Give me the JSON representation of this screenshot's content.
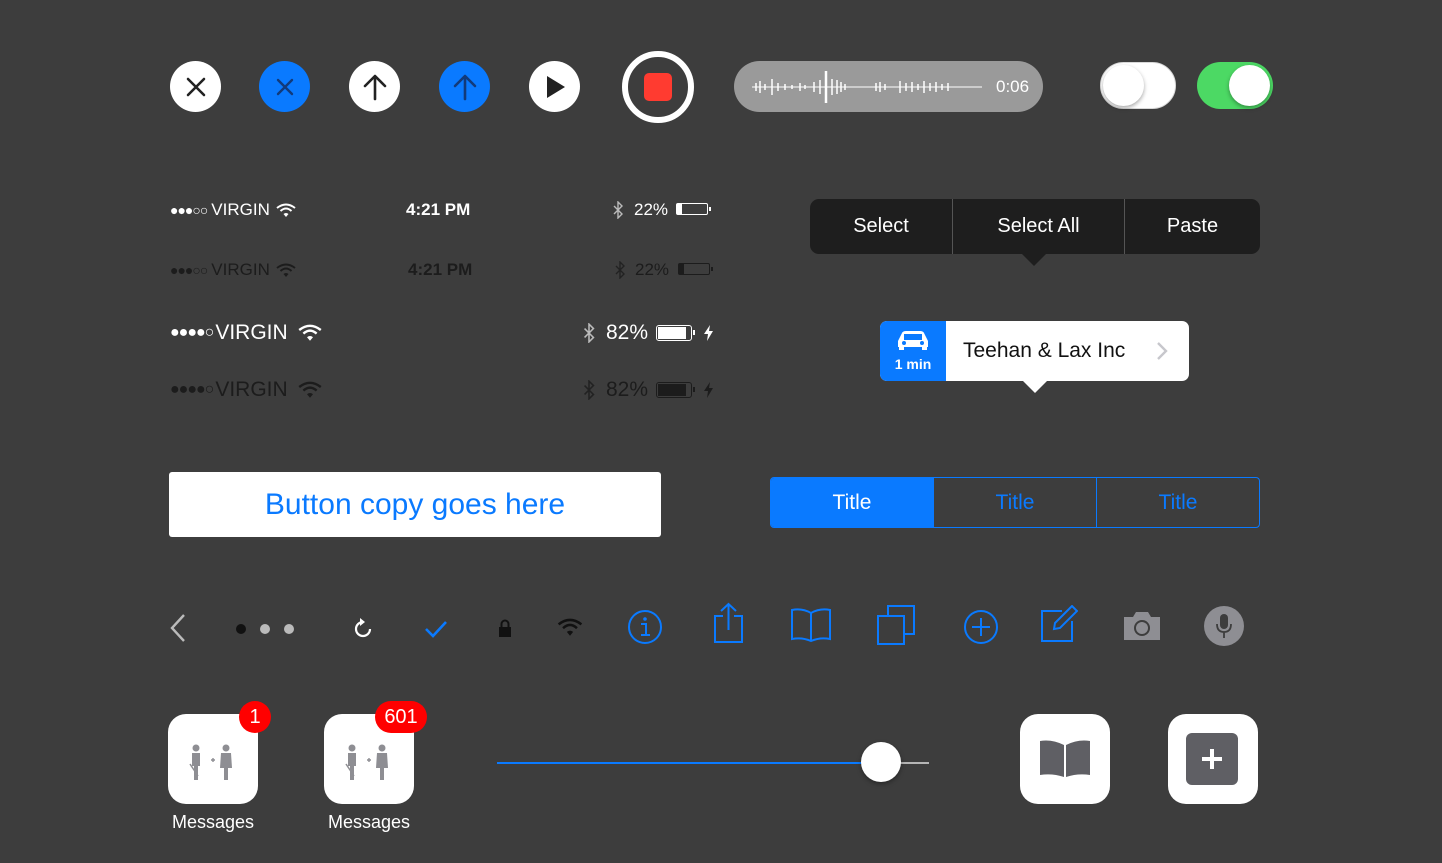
{
  "audio": {
    "duration": "0:06"
  },
  "toggles": [
    {
      "state": "off"
    },
    {
      "state": "on"
    }
  ],
  "status_bars": [
    {
      "signal": "●●●○○",
      "carrier": "VIRGIN",
      "time": "4:21 PM",
      "battery": "22%"
    },
    {
      "signal": "●●●○○",
      "carrier": "VIRGIN",
      "time": "4:21 PM",
      "battery": "22%"
    },
    {
      "signal": "●●●●○",
      "carrier": "VIRGIN",
      "battery": "82%"
    },
    {
      "signal": "●●●●○",
      "carrier": "VIRGIN",
      "battery": "82%"
    }
  ],
  "edit_menu": {
    "items": [
      "Select",
      "Select All",
      "Paste"
    ]
  },
  "map_callout": {
    "eta": "1 min",
    "title": "Teehan & Lax Inc"
  },
  "button": {
    "label": "Button copy goes here"
  },
  "segmented": {
    "items": [
      "Title",
      "Title",
      "Title"
    ],
    "selected": 0
  },
  "page_indicator": {
    "count": 3,
    "current": 0
  },
  "apps": [
    {
      "label": "Messages",
      "badge": "1"
    },
    {
      "label": "Messages",
      "badge": "601"
    }
  ],
  "slider": {
    "value": 0.89
  },
  "colors": {
    "accent": "#0a7aff",
    "background": "#3d3d3d",
    "toggle_on": "#4cd964",
    "record": "#ff3b30",
    "badge": "#ff0000"
  }
}
